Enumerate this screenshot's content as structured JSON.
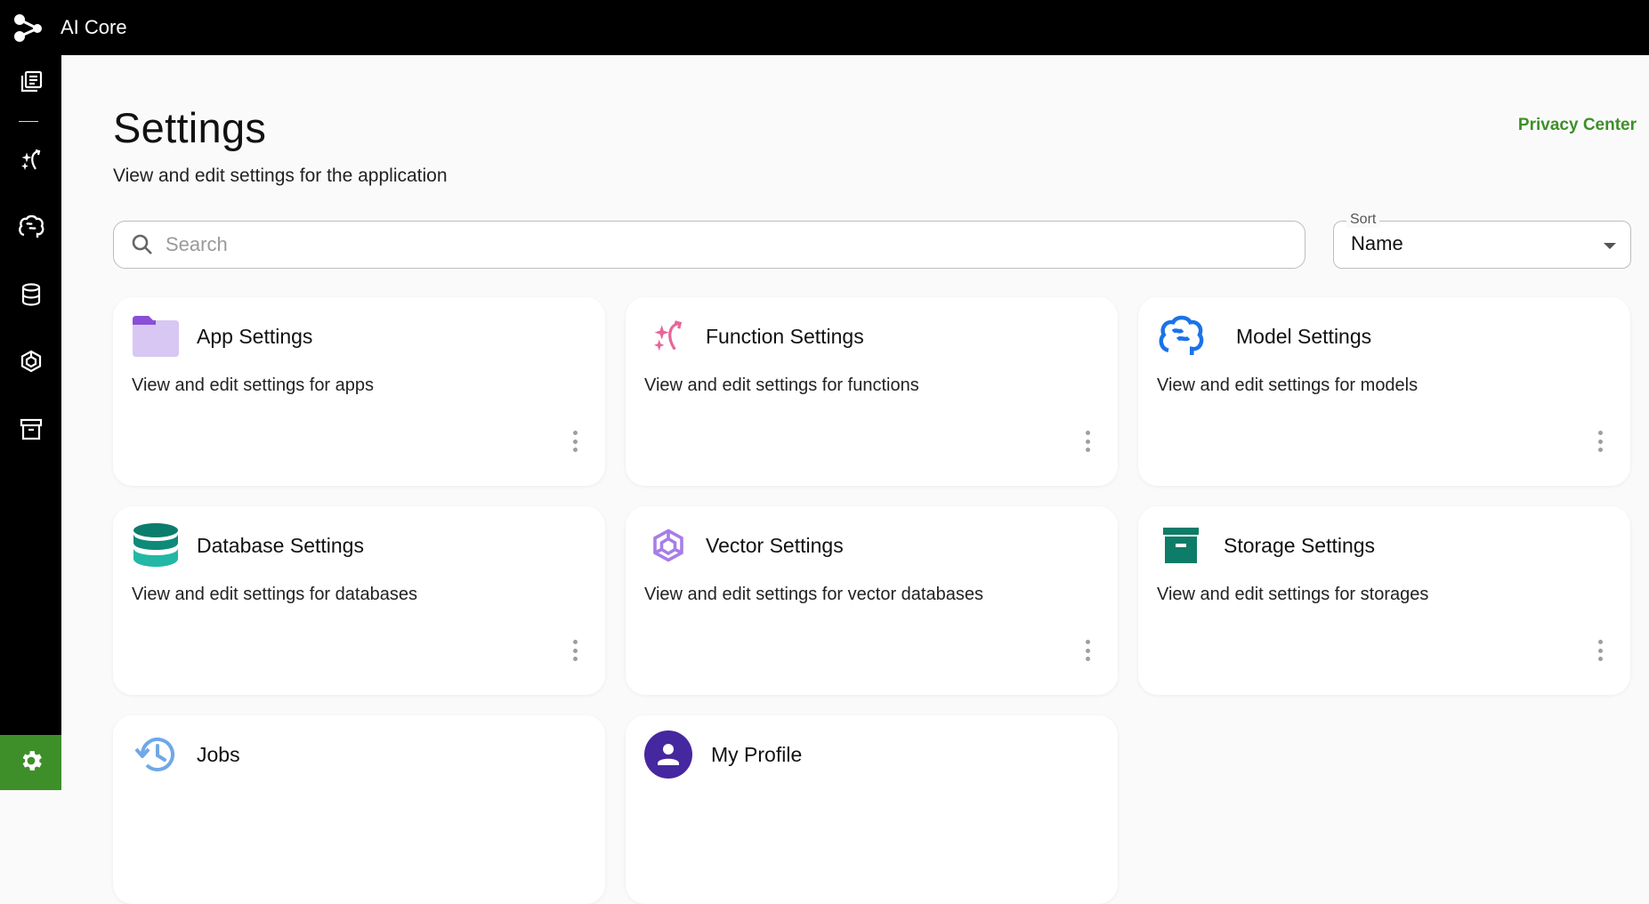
{
  "app": {
    "title": "AI Core"
  },
  "page": {
    "title": "Settings",
    "subtitle": "View and edit settings for the application",
    "privacy_link": "Privacy Center"
  },
  "search": {
    "placeholder": "Search",
    "value": ""
  },
  "sort": {
    "label": "Sort",
    "value": "Name"
  },
  "sidebar": {
    "items": [
      {
        "name": "catalog",
        "icon": "library-books-icon"
      },
      {
        "name": "functions",
        "icon": "sparkle-function-icon"
      },
      {
        "name": "models",
        "icon": "brain-icon"
      },
      {
        "name": "databases",
        "icon": "database-icon"
      },
      {
        "name": "vectors",
        "icon": "hexagon-cube-icon"
      },
      {
        "name": "storages",
        "icon": "archive-icon"
      }
    ],
    "settings": {
      "icon": "gear-icon",
      "color": "#3e8f2a"
    }
  },
  "cards": [
    {
      "title": "App Settings",
      "description": "View and edit settings for apps",
      "icon": "folder-icon"
    },
    {
      "title": "Function Settings",
      "description": "View and edit settings for functions",
      "icon": "sparkle-function-icon"
    },
    {
      "title": "Model Settings",
      "description": "View and edit settings for models",
      "icon": "brain-icon"
    },
    {
      "title": "Database Settings",
      "description": "View and edit settings for databases",
      "icon": "database-icon"
    },
    {
      "title": "Vector Settings",
      "description": "View and edit settings for vector databases",
      "icon": "hexagon-cube-icon"
    },
    {
      "title": "Storage Settings",
      "description": "View and edit settings for storages",
      "icon": "archive-icon"
    },
    {
      "title": "Jobs",
      "description": "",
      "icon": "history-icon"
    },
    {
      "title": "My Profile",
      "description": "",
      "icon": "person-icon"
    }
  ],
  "colors": {
    "accent": "#3e8f2a",
    "folder": "#c9b3ef",
    "function": "#e8659a",
    "model": "#1a73e8",
    "database": "#0e8a78",
    "vector": "#a77ee6",
    "storage": "#0d7c68",
    "jobs": "#6fa8e8",
    "profile": "#4527a0"
  }
}
